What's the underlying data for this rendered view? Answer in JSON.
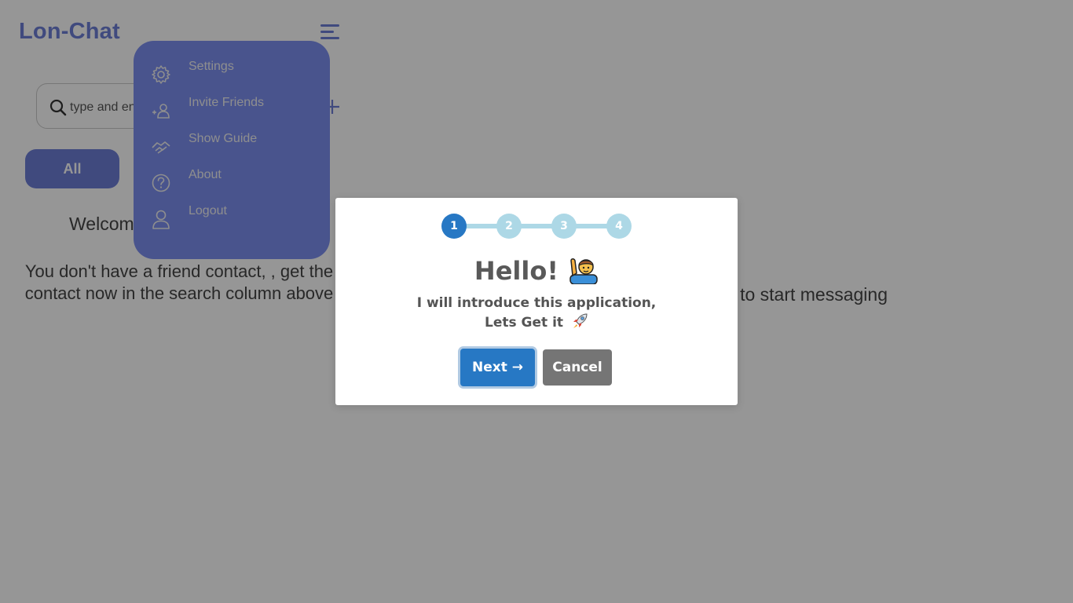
{
  "app": {
    "brand": "Lon-Chat"
  },
  "search": {
    "placeholder": "type and enter friend's email"
  },
  "tabs": {
    "all_label": "All"
  },
  "main": {
    "welcome": "Welcome",
    "empty_text": "You don't have a friend contact, , get the contact now in the search column above",
    "start_messaging": "Select a friend contact to start messaging"
  },
  "menu": {
    "items": [
      {
        "label": "Settings",
        "icon": "gear-icon"
      },
      {
        "label": "Invite Friends",
        "icon": "add-user-icon"
      },
      {
        "label": "Show Guide",
        "icon": "handshake-icon"
      },
      {
        "label": "About",
        "icon": "question-icon"
      },
      {
        "label": "Logout",
        "icon": "user-icon"
      }
    ]
  },
  "guide": {
    "steps": [
      "1",
      "2",
      "3",
      "4"
    ],
    "active_step": 1,
    "title": "Hello!",
    "text_line1": "I will introduce this application,",
    "text_line2": "Lets Get it",
    "next_label": "Next →",
    "cancel_label": "Cancel"
  },
  "colors": {
    "brand": "#6d7fd7",
    "menu_bg": "#7d8ff0",
    "step_active": "#2778c4",
    "step_inactive": "#add8e6",
    "next_button": "#2778c4",
    "cancel_button": "#757575"
  }
}
